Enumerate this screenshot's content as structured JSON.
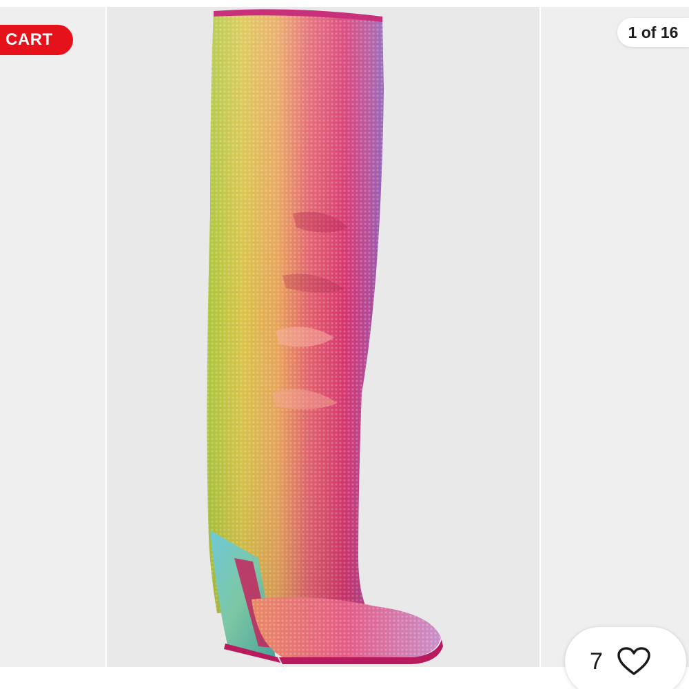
{
  "cart": {
    "label": "CART"
  },
  "gallery": {
    "counter": "1 of 16"
  },
  "favorites": {
    "count": "7",
    "icon": "heart-outline-icon"
  },
  "colors": {
    "cart_red": "#e5121c",
    "stage_bg": "#e9e9ea",
    "side_bg": "#efefef"
  }
}
